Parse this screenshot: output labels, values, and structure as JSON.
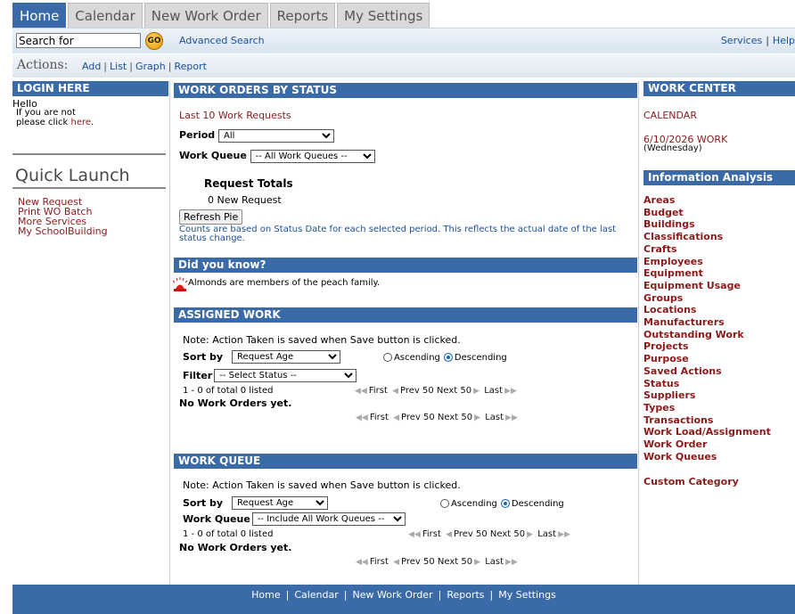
{
  "tabs": [
    {
      "label": "Home"
    },
    {
      "label": "Calendar"
    },
    {
      "label": "New Work Order"
    },
    {
      "label": "Reports"
    },
    {
      "label": "My Settings"
    }
  ],
  "search": {
    "value": "Search for",
    "go_label": "GO",
    "advanced_label": "Advanced Search"
  },
  "top_links": {
    "services": "Services",
    "help": "Help"
  },
  "actions": {
    "label": "Actions:",
    "add": "Add",
    "list": "List",
    "graph": "Graph",
    "report": "Report"
  },
  "login": {
    "header": "LOGIN HERE",
    "hello": "Hello",
    "line1": "If you are not",
    "line2_prefix": "please click ",
    "here": "here",
    "line2_suffix": "."
  },
  "quick_launch": {
    "title": "Quick Launch",
    "items": [
      "New Request",
      "Print WO Batch",
      "More Services",
      "My SchoolBuilding"
    ]
  },
  "status_panel": {
    "header": "WORK ORDERS BY STATUS",
    "last10": "Last 10 Work Requests",
    "period_label": "Period",
    "period_value": "All",
    "queue_label": "Work Queue",
    "queue_value": "-- All Work Queues --",
    "totals_title": "Request Totals",
    "new_request": "0 New Request",
    "refresh_label": "Refresh Pie",
    "note": "Counts are based on Status Date for each selected period. This reflects the actual date of the last status change."
  },
  "did_you_know": {
    "header": "Did you know?",
    "text": "Almonds are members of the peach family."
  },
  "assigned": {
    "header": "ASSIGNED WORK",
    "note": "Note: Action Taken is saved when Save button is clicked.",
    "sort_label": "Sort by",
    "sort_value": "Request Age",
    "asc": "Ascending",
    "desc": "Descending",
    "filter_label": "Filter",
    "filter_value": "-- Select Status --",
    "listed": "1 - 0 of total 0 listed",
    "empty": "No Work Orders yet."
  },
  "queue": {
    "header": "WORK QUEUE",
    "note": "Note: Action Taken is saved when Save button is clicked.",
    "sort_label": "Sort by",
    "sort_value": "Request Age",
    "asc": "Ascending",
    "desc": "Descending",
    "queue_label": "Work Queue",
    "queue_value": "-- Include All Work Queues --",
    "listed": "1 - 0 of total 0 listed",
    "empty": "No Work Orders yet."
  },
  "pager": {
    "first": "First",
    "prev": "Prev 50",
    "next": "Next 50",
    "last": "Last"
  },
  "work_center": {
    "header": "WORK CENTER",
    "calendar": "CALENDAR",
    "date_line": "6/10/2026 WORK",
    "day": "(Wednesday)"
  },
  "info_analysis": {
    "header": "Information Analysis",
    "items": [
      "Areas",
      "Budget",
      "Buildings",
      "Classifications",
      "Crafts",
      "Employees",
      "Equipment",
      "Equipment Usage",
      "Groups",
      "Locations",
      "Manufacturers",
      "Outstanding Work",
      "Projects",
      "Purpose",
      "Saved Actions",
      "Status",
      "Suppliers",
      "Types",
      "Transactions",
      "Work Load/Assignment",
      "Work Order",
      "Work Queues"
    ],
    "custom": "Custom Category"
  },
  "footer": [
    "Home",
    "Calendar",
    "New Work Order",
    "Reports",
    "My Settings"
  ]
}
